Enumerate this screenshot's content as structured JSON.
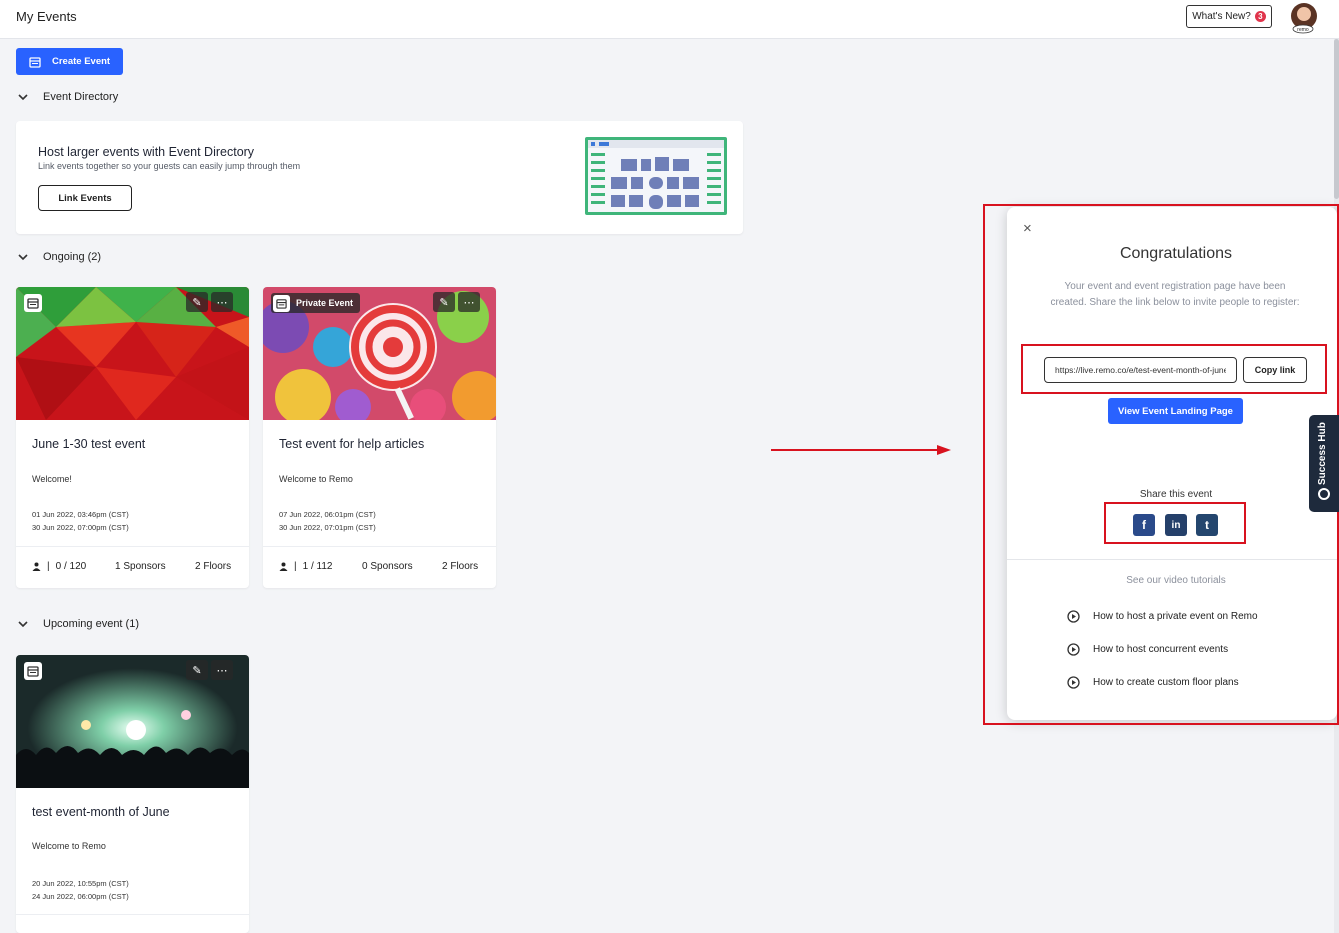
{
  "header": {
    "title": "My Events",
    "whats_new": "What's New?",
    "whats_new_count": "3"
  },
  "actions": {
    "create_event": "Create Event"
  },
  "event_directory": {
    "section_label": "Event Directory",
    "heading": "Host larger events with Event Directory",
    "subtext": "Link events together so your guests can easily jump through them",
    "link_button": "Link Events"
  },
  "ongoing": {
    "section_label": "Ongoing (2)",
    "events": [
      {
        "name": "June 1-30 test event",
        "description": "Welcome!",
        "start": "01 Jun 2022, 03:46pm (CST)",
        "end": "30 Jun 2022, 07:00pm (CST)",
        "capacity": "0 / 120",
        "sponsors": "1 Sponsors",
        "floors": "2 Floors"
      },
      {
        "badge": "Private Event",
        "name": "Test event for help articles",
        "description": "Welcome to Remo",
        "start": "07 Jun 2022, 06:01pm (CST)",
        "end": "30 Jun 2022, 07:01pm (CST)",
        "capacity": "1 / 112",
        "sponsors": "0 Sponsors",
        "floors": "2 Floors"
      }
    ]
  },
  "upcoming": {
    "section_label": "Upcoming event (1)",
    "events": [
      {
        "name": "test event-month of June",
        "description": "Welcome to Remo",
        "start": "20 Jun 2022, 10:55pm (CST)",
        "end": "24 Jun 2022, 06:00pm (CST)"
      }
    ]
  },
  "modal": {
    "close": "×",
    "title": "Congratulations",
    "message": "Your event and event registration page have been created. Share the link below to invite people to register:",
    "url": "https://live.remo.co/e/test-event-month-of-june",
    "copy_link": "Copy link",
    "view_landing": "View Event Landing Page",
    "share_label": "Share this event",
    "social": {
      "facebook": "f",
      "linkedin": "in",
      "twitter": "t"
    },
    "tutorials_label": "See our video tutorials",
    "tutorials": [
      "How to host a private event on Remo",
      "How to host concurrent events",
      "How to create custom floor plans"
    ]
  },
  "success_hub": {
    "label": "Success Hub"
  },
  "colors": {
    "primary": "#2962ff",
    "highlight": "#d8121f",
    "background": "#f3f4f7"
  },
  "icons": {
    "calendar": "calendar-icon",
    "edit": "pencil-icon",
    "more": "more-icon",
    "person": "person-icon",
    "play": "play-circle-icon",
    "chevron": "chevron-down-icon"
  }
}
